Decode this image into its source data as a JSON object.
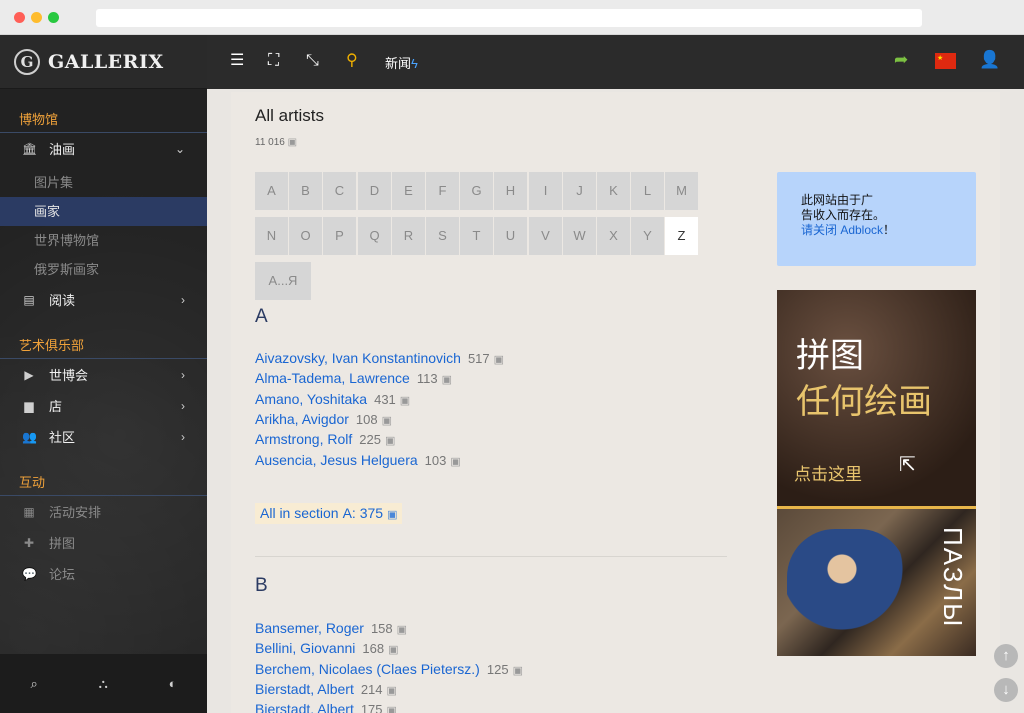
{
  "sidebar": {
    "logo_mark": "G",
    "logo": "GALLERIX",
    "sections": {
      "museum": "博物馆",
      "club": "艺术俱乐部",
      "interactive": "互动"
    },
    "items": {
      "paintings": "油画",
      "gallery": "图片集",
      "artists": "画家",
      "world_museums": "世界博物馆",
      "russian_artists": "俄罗斯画家",
      "reading": "阅读",
      "expo": "世博会",
      "shop": "店",
      "community": "社区",
      "events": "活动安排",
      "puzzle": "拼图",
      "forum": "论坛"
    }
  },
  "topbar": {
    "news_label": "新闻"
  },
  "page": {
    "title": "All artists",
    "total_count": "11 016"
  },
  "alphabet": [
    "A",
    "B",
    "C",
    "D",
    "E",
    "F",
    "G",
    "H",
    "I",
    "J",
    "K",
    "L",
    "M",
    "N",
    "O",
    "P",
    "Q",
    "R",
    "S",
    "T",
    "U",
    "V",
    "W",
    "X",
    "Y",
    "Z",
    "А...Я"
  ],
  "active_letter": "Z",
  "sections": [
    {
      "letter": "A",
      "artists": [
        {
          "name": "Aivazovsky, Ivan Konstantinovich",
          "count": "517"
        },
        {
          "name": "Alma-Tadema, Lawrence",
          "count": "113"
        },
        {
          "name": "Amano, Yoshitaka",
          "count": "431"
        },
        {
          "name": "Arikha, Avigdor",
          "count": "108"
        },
        {
          "name": "Armstrong, Rolf",
          "count": "225"
        },
        {
          "name": "Ausencia, Jesus Helguera",
          "count": "103"
        }
      ],
      "all_in_section_label": "All in section",
      "all_in_section_value": "A: 375"
    },
    {
      "letter": "B",
      "artists": [
        {
          "name": "Bansemer, Roger",
          "count": "158"
        },
        {
          "name": "Bellini, Giovanni",
          "count": "168"
        },
        {
          "name": "Berchem, Nicolaes (Claes Pietersz.)",
          "count": "125"
        },
        {
          "name": "Bierstadt, Albert",
          "count": "214"
        },
        {
          "name": "Bierstadt, Albert",
          "count": "175"
        }
      ]
    }
  ],
  "adblock": {
    "line1": "此网站由于广",
    "line2": "告收入而存在。",
    "link": "请关闭 Adblock",
    "after": "！"
  },
  "banner": {
    "line1": "拼图",
    "line2": "任何绘画",
    "cta": "点击这里",
    "side_text": "ПАЗЛЫ"
  },
  "colors": {
    "accent_orange": "#f0a23a",
    "link_blue": "#1a66d2",
    "sidebar_active": "#2b3b63"
  }
}
